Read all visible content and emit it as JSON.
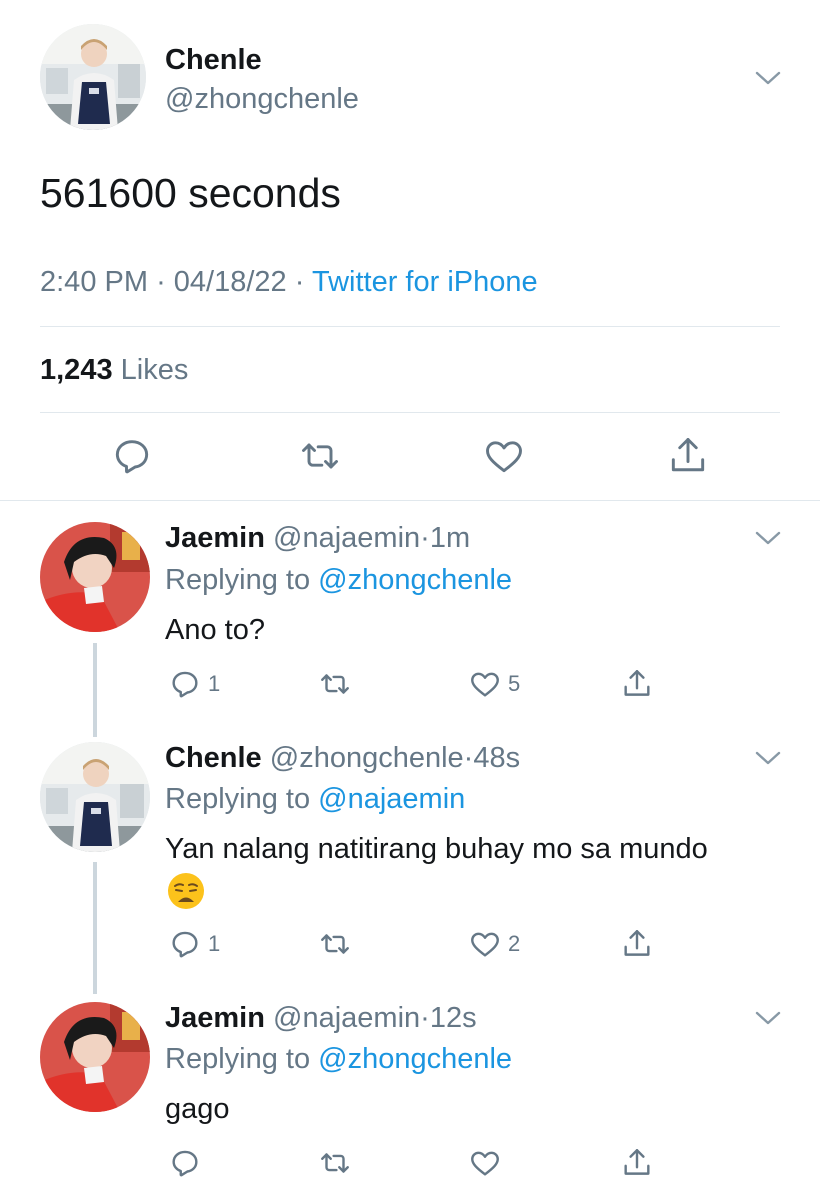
{
  "main_tweet": {
    "name": "Chenle",
    "handle": "@zhongchenle",
    "text": "561600 seconds",
    "time": "2:40 PM",
    "date": "04/18/22",
    "separator": "·",
    "source": "Twitter for iPhone",
    "likes_count": "1,243",
    "likes_label": "Likes"
  },
  "replies": [
    {
      "name": "Jaemin",
      "handle": "@najaemin",
      "dot": "·",
      "age": "1m",
      "replying_label": "Replying to",
      "replying_to": "@zhongchenle",
      "text": "Ano to?",
      "reply_count": "1",
      "like_count": "5"
    },
    {
      "name": "Chenle",
      "handle": "@zhongchenle",
      "dot": "·",
      "age": "48s",
      "replying_label": "Replying to",
      "replying_to": "@najaemin",
      "text": "Yan nalang natitirang buhay mo sa mundo",
      "reply_count": "1",
      "like_count": "2"
    },
    {
      "name": "Jaemin",
      "handle": "@najaemin",
      "dot": "·",
      "age": "12s",
      "replying_label": "Replying to",
      "replying_to": "@zhongchenle",
      "text": "gago",
      "reply_count": "",
      "like_count": ""
    }
  ],
  "icons": {
    "reply": "reply-icon",
    "retweet": "retweet-icon",
    "like": "heart-icon",
    "share": "share-icon",
    "more": "chevron-down-icon",
    "emoji": "weary-face-emoji"
  },
  "colors": {
    "link": "#1b95e0",
    "secondary_text": "#657786",
    "primary_text": "#14171a",
    "divider": "#e1e8ed",
    "thread_line": "#ccd6dd",
    "icon": "#657786"
  }
}
